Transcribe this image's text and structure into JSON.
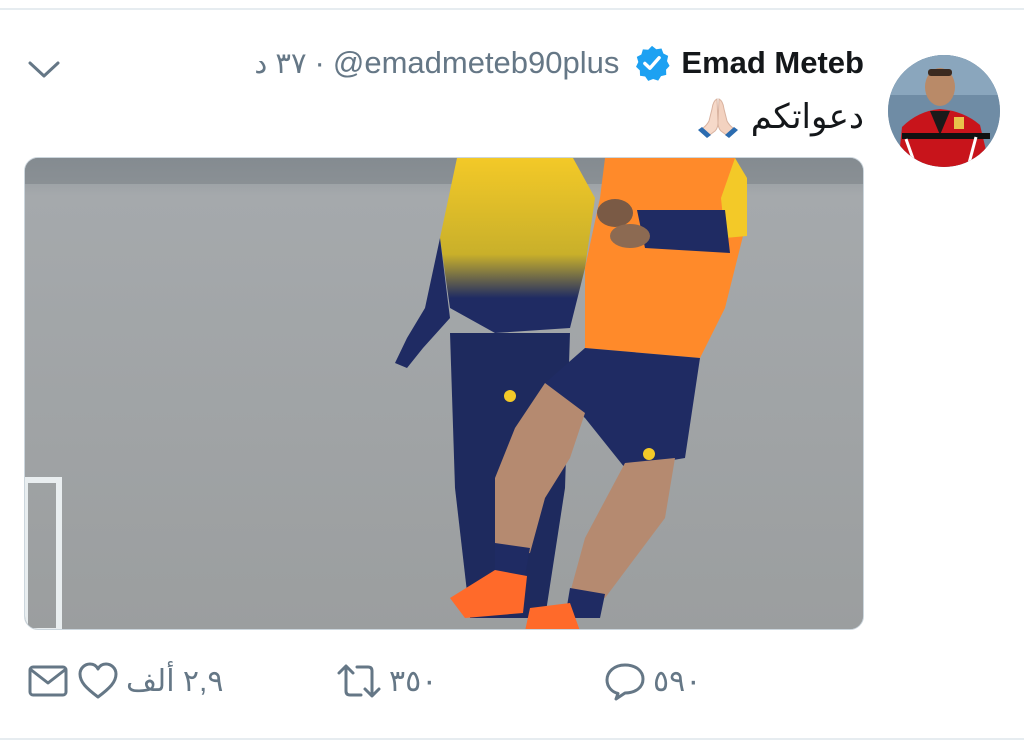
{
  "tweet": {
    "display_name": "Emad Meteb",
    "handle": "@emadmeteb90plus",
    "separator": "·",
    "time": "٣٧ د",
    "text": "دعواتكم",
    "emoji": "🙏🏻"
  },
  "actions": {
    "reply_count": "٥٩٠",
    "retweet_count": "٣٥٠",
    "like_count": "٢,٩ ألف"
  },
  "colors": {
    "verified": "#1da1f2",
    "secondary_text": "#657786",
    "primary_text": "#14171a",
    "divider": "#e6ecf0"
  },
  "icons": [
    "chevron-down-icon",
    "verified-badge-icon",
    "praying-hands-icon",
    "reply-icon",
    "retweet-icon",
    "like-icon",
    "direct-message-icon"
  ]
}
